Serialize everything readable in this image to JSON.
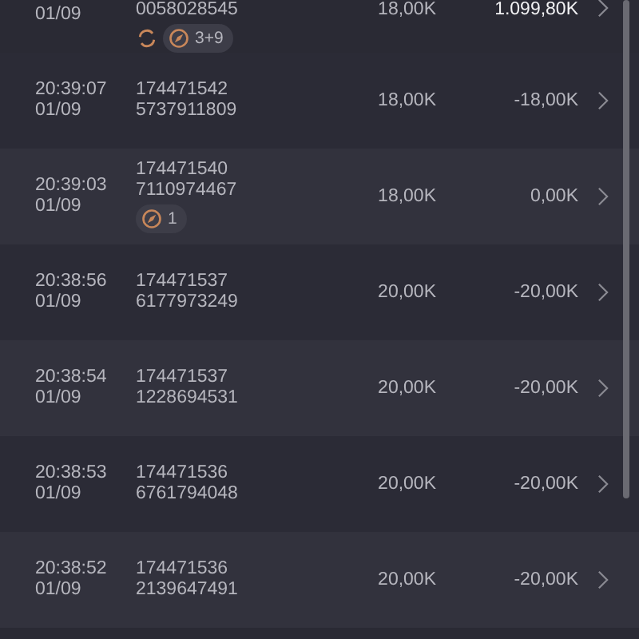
{
  "rows": [
    {
      "partial": true,
      "date": "01/09",
      "id": [
        "0058028545"
      ],
      "badges": [
        {
          "kind": "refresh"
        },
        {
          "kind": "compass",
          "label": "3+9"
        }
      ],
      "stake": "18,00K",
      "result": "1.099,80K",
      "highlighted": true
    },
    {
      "partial": false,
      "time": "20:39:07",
      "date": "01/09",
      "id": [
        "174471542",
        "5737911809"
      ],
      "stake": "18,00K",
      "result": "-18,00K",
      "highlighted": false
    },
    {
      "partial": false,
      "time": "20:39:03",
      "date": "01/09",
      "id": [
        "174471540",
        "7110974467"
      ],
      "badges": [
        {
          "kind": "compass",
          "label": "1"
        }
      ],
      "stake": "18,00K",
      "result": "0,00K",
      "highlighted": false
    },
    {
      "partial": false,
      "time": "20:38:56",
      "date": "01/09",
      "id": [
        "174471537",
        "6177973249"
      ],
      "stake": "20,00K",
      "result": "-20,00K",
      "highlighted": false
    },
    {
      "partial": false,
      "time": "20:38:54",
      "date": "01/09",
      "id": [
        "174471537",
        "1228694531"
      ],
      "stake": "20,00K",
      "result": "-20,00K",
      "highlighted": false
    },
    {
      "partial": false,
      "time": "20:38:53",
      "date": "01/09",
      "id": [
        "174471536",
        "6761794048"
      ],
      "stake": "20,00K",
      "result": "-20,00K",
      "highlighted": false
    },
    {
      "partial": false,
      "time": "20:38:52",
      "date": "01/09",
      "id": [
        "174471536",
        "2139647491"
      ],
      "stake": "20,00K",
      "result": "-20,00K",
      "highlighted": false
    }
  ]
}
